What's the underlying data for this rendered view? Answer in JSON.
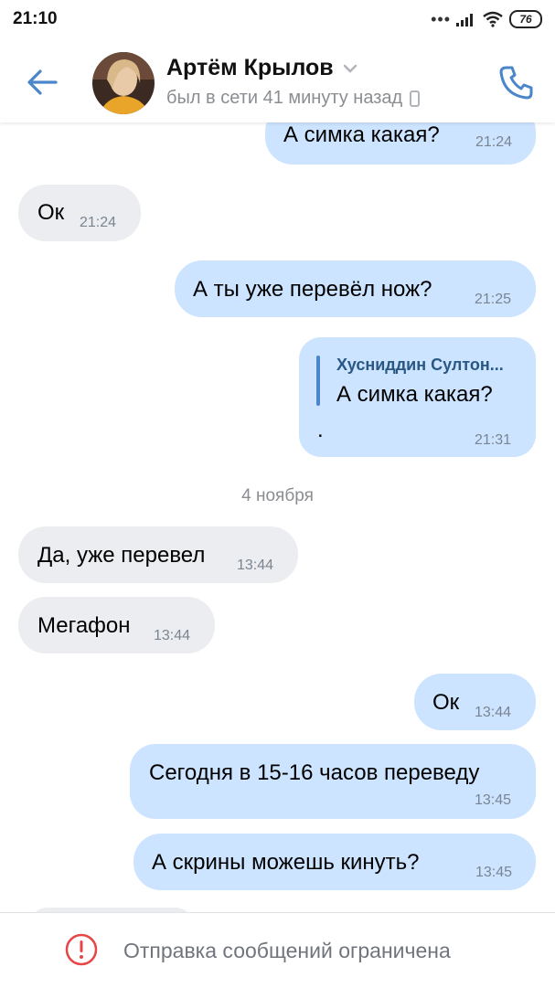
{
  "status_bar": {
    "time": "21:10",
    "signal_dots": "•••",
    "battery": "76"
  },
  "header": {
    "name": "Артём Крылов",
    "last_seen": "был в сети 41 минуту назад"
  },
  "messages": [
    {
      "dir": "out",
      "text": "А симка какая?",
      "time": "21:24"
    },
    {
      "dir": "in",
      "text": "Ок",
      "time": "21:24"
    },
    {
      "dir": "out",
      "text": "А ты уже перевёл нож?",
      "time": "21:25"
    },
    {
      "dir": "out",
      "reply_author": "Хусниддин Султон...",
      "text": "А симка какая?",
      "extra": ".",
      "time": "21:31"
    },
    {
      "dir": "in",
      "text": "Да, уже перевел",
      "time": "13:44"
    },
    {
      "dir": "in",
      "text": "Мегафон",
      "time": "13:44"
    },
    {
      "dir": "out",
      "text": "Ок",
      "time": "13:44"
    },
    {
      "dir": "out",
      "text": "Сегодня в 15-16 часов переведу",
      "time": "13:45"
    },
    {
      "dir": "out",
      "text": "А скрины можешь кинуть?",
      "time": "13:45"
    }
  ],
  "date_separator": "4 ноября",
  "bottom": {
    "restriction_text": "Отправка сообщений ограничена"
  },
  "colors": {
    "accent": "#4a86c9",
    "incoming_bubble": "#ebedf0",
    "outgoing_bubble": "#cce4ff",
    "warning": "#e64646"
  }
}
